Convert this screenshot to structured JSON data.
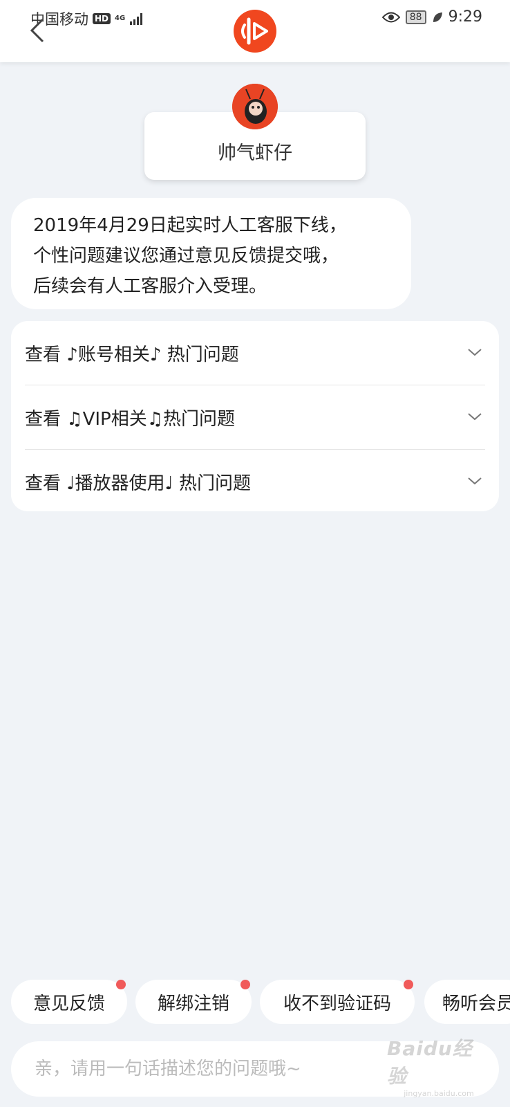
{
  "status_bar": {
    "carrier": "中国移动",
    "hd": "HD",
    "network": "4G",
    "battery": "88",
    "time": "9:29"
  },
  "header": {
    "back_icon": "chevron-left-icon",
    "logo_icon": "app-logo-icon",
    "accent_color": "#f0471f"
  },
  "bot": {
    "name": "帅气虾仔",
    "avatar_icon": "shrimp-avatar-icon"
  },
  "message": {
    "lines": [
      "2019年4月29日起实时人工客服下线，",
      "个性问题建议您通过意见反馈提交哦，",
      "后续会有人工客服介入受理。"
    ]
  },
  "faq": {
    "items": [
      {
        "label": "查看 ♪账号相关♪ 热门问题"
      },
      {
        "label": "查看 ♫VIP相关♫热门问题"
      },
      {
        "label": "查看 ♩播放器使用♩ 热门问题"
      }
    ]
  },
  "quick_actions": [
    {
      "label": "意见反馈",
      "badge": true
    },
    {
      "label": "解绑注销",
      "badge": true
    },
    {
      "label": "收不到验证码",
      "badge": true
    },
    {
      "label": "畅听会员",
      "badge": false
    }
  ],
  "input": {
    "placeholder": "亲，请用一句话描述您的问题哦~"
  },
  "watermark": {
    "main": "Baidu经验",
    "sub": "jingyan.baidu.com"
  }
}
